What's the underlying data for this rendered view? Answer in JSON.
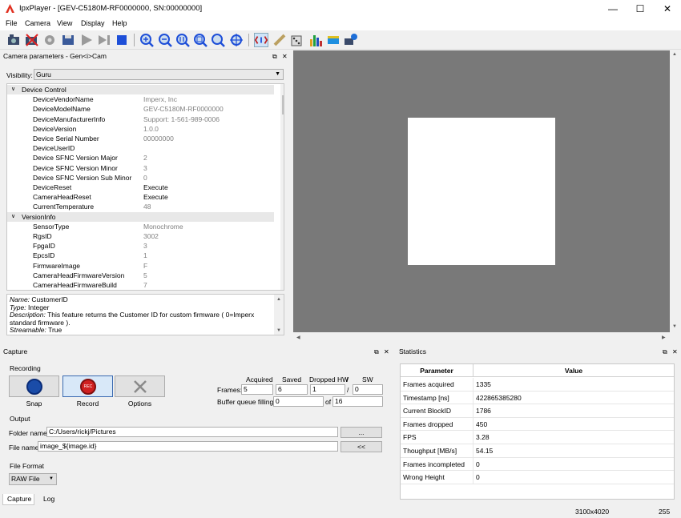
{
  "window": {
    "title": "IpxPlayer - [GEV-C5180M-RF0000000, SN:00000000]"
  },
  "menu": [
    "File",
    "Camera",
    "View",
    "Display",
    "Help"
  ],
  "toolbar": {
    "icons": [
      "camera-open-icon",
      "camera-close-icon",
      "settings-gear-icon",
      "save-config-icon",
      "play-icon",
      "step-icon",
      "stop-icon",
      "zoom-in-icon",
      "zoom-out-icon",
      "zoom-1to1-icon",
      "zoom-fit-icon",
      "zoom-region-icon",
      "zoom-center-icon",
      "genicam-icon",
      "lightbulb-icon",
      "dice-icon",
      "histogram-icon",
      "color-bar-icon",
      "network-camera-icon"
    ]
  },
  "camera_params": {
    "title": "Camera parameters - Gen<i>Cam",
    "visibility_label": "Visibility:",
    "visibility_value": "Guru",
    "rows": [
      {
        "type": "cat",
        "name": "Device Control"
      },
      {
        "name": "DeviceVendorName",
        "value": "Imperx, Inc",
        "grey": true
      },
      {
        "name": "DeviceModelName",
        "value": "GEV-C5180M-RF0000000",
        "grey": true
      },
      {
        "name": "DeviceManufacturerInfo",
        "value": "Support: 1-561-989-0006",
        "grey": true
      },
      {
        "name": "DeviceVersion",
        "value": "1.0.0",
        "grey": true
      },
      {
        "name": "Device Serial Number",
        "value": "00000000",
        "grey": true
      },
      {
        "name": "DeviceUserID",
        "value": "",
        "grey": true
      },
      {
        "name": "Device SFNC Version Major",
        "value": "2",
        "grey": true
      },
      {
        "name": "Device SFNC Version Minor",
        "value": "3",
        "grey": true
      },
      {
        "name": "Device SFNC Version Sub Minor",
        "value": "0",
        "grey": true
      },
      {
        "name": "DeviceReset",
        "value": "Execute",
        "grey": false
      },
      {
        "name": "CameraHeadReset",
        "value": "Execute",
        "grey": false
      },
      {
        "name": "CurrentTemperature",
        "value": "48",
        "grey": true
      },
      {
        "type": "cat",
        "name": "VersionInfo"
      },
      {
        "name": "SensorType",
        "value": "Monochrome",
        "grey": true
      },
      {
        "name": "RgsID",
        "value": "3002",
        "grey": true
      },
      {
        "name": "FpgaID",
        "value": "3",
        "grey": true
      },
      {
        "name": "EpcsID",
        "value": "1",
        "grey": true
      },
      {
        "name": "FirmwareImage",
        "value": "F",
        "grey": true
      },
      {
        "name": "CameraHeadFirmwareVersion",
        "value": "5",
        "grey": true
      },
      {
        "name": "CameraHeadFirmwareBuild",
        "value": "7",
        "grey": true
      }
    ],
    "description": {
      "name_label": "Name:",
      "name": "CustomerID",
      "type_label": "Type:",
      "type": "Integer",
      "desc_label": "Description:",
      "desc": "This feature returns the Customer ID for custom firmware ( 0=Imperx standard firmware ).",
      "stream_label": "Streamable:",
      "stream": "True"
    }
  },
  "capture": {
    "title": "Capture",
    "recording_label": "Recording",
    "snap_label": "Snap",
    "record_label": "Record",
    "options_label": "Options",
    "rec_text": "REC",
    "acquired_label": "Acquired",
    "saved_label": "Saved",
    "dropped_hw_label": "Dropped HW",
    "slash": "/",
    "sw_label": "SW",
    "frames_label": "Frames:",
    "frames_acquired": "5",
    "frames_saved": "6",
    "frames_dropped_hw": "1",
    "frames_sw": "0",
    "buffer_label": "Buffer queue filling:",
    "buffer_value": "0",
    "of_label": "of",
    "buffer_total": "16",
    "output_label": "Output",
    "folder_label": "Folder name:",
    "folder_value": "C:/Users/rickj/Pictures",
    "browse_label": "...",
    "file_label": "File name:",
    "file_value": "image_${image.id}",
    "insert_label": "<<",
    "format_label": "File Format",
    "format_value": "RAW File",
    "tabs": [
      "Capture",
      "Log"
    ]
  },
  "statistics": {
    "title": "Statistics",
    "col_param": "Parameter",
    "col_value": "Value",
    "rows": [
      {
        "p": "Frames acquired",
        "v": "1335"
      },
      {
        "p": "Timestamp [ns]",
        "v": "422865385280"
      },
      {
        "p": "Current BlockID",
        "v": "1786"
      },
      {
        "p": "Frames dropped",
        "v": "450"
      },
      {
        "p": "FPS",
        "v": "3.28"
      },
      {
        "p": "Thoughput [MB/s]",
        "v": "54.15"
      },
      {
        "p": "Frames incompleted",
        "v": "0"
      },
      {
        "p": "Wrong Height",
        "v": "0"
      }
    ]
  },
  "status": {
    "resolution": "3100x4020",
    "pixel": "255"
  }
}
